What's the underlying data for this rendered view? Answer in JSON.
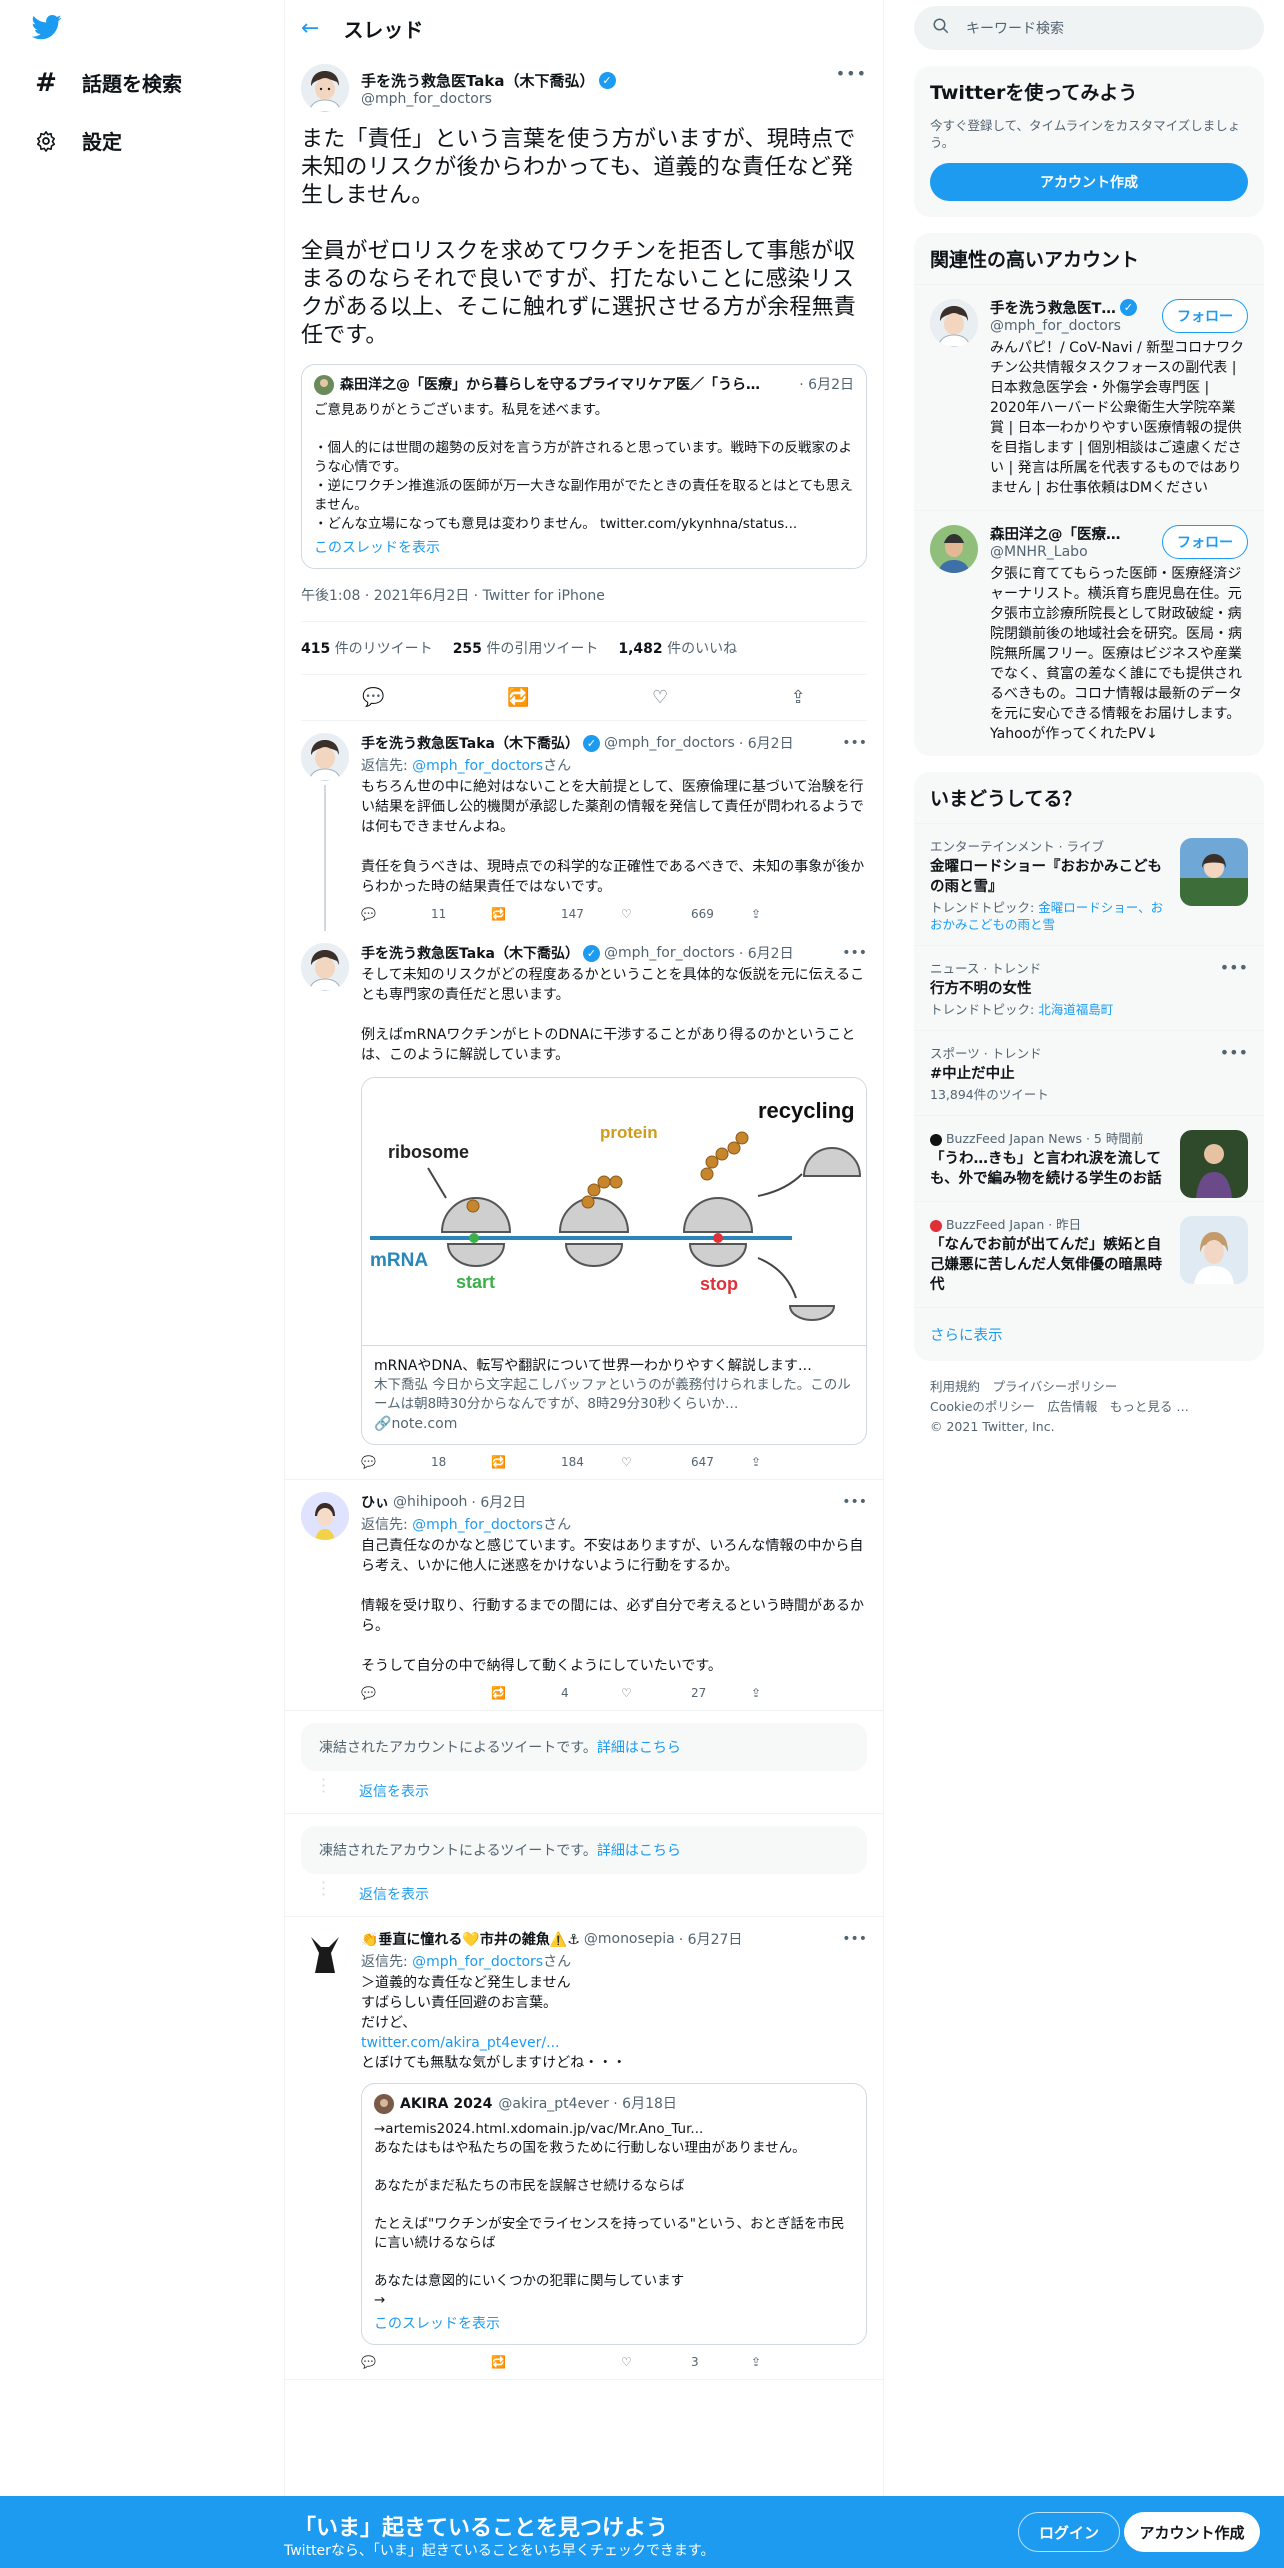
{
  "left_nav": {
    "items": [
      {
        "icon": "hashtag-icon",
        "label": "話題を検索"
      },
      {
        "icon": "gear-icon",
        "label": "設定"
      }
    ]
  },
  "header": {
    "title": "スレッド"
  },
  "focal": {
    "name": "手を洗う救急医Taka（木下喬弘）",
    "handle": "@mph_for_doctors",
    "text": "また「責任」という言葉を使う方がいますが、現時点で未知のリスクが後からわかっても、道義的な責任など発生しません。\n\n全員がゼロリスクを求めてワクチンを拒否して事態が収まるのならそれで良いですが、打たないことに感染リスクがある以上、そこに触れずに選択させる方が余程無責任です。",
    "quote": {
      "name": "森田洋之@「医療」から暮らしを守るプライマリケア医／「うら…",
      "date": "· 6月2日",
      "text": "ご意見ありがとうございます。私見を述べます。\n\n・個人的には世間の趨勢の反対を言う方が許されると思っています。戦時下の反戦家のような心情です。\n・逆にワクチン推進派の医師が万一大きな副作用がでたときの責任を取るとはとても思えません。\n・どんな立場になっても意見は変わりません。",
      "link": "twitter.com/ykynhna/status...",
      "show_thread": "このスレッドを表示"
    },
    "meta": "午後1:08 · 2021年6月2日 · Twitter for iPhone",
    "retweets": "415",
    "retweets_label": "件のリツイート",
    "quotes": "255",
    "quotes_label": "件の引用ツイート",
    "likes": "1,482",
    "likes_label": "件のいいね"
  },
  "replies": [
    {
      "name": "手を洗う救急医Taka（木下喬弘）",
      "handle": "@mph_for_doctors",
      "date": "· 6月2日",
      "reply_prefix": "返信先: ",
      "reply_to": "@mph_for_doctors",
      "reply_suffix": "さん",
      "text": "もちろん世の中に絶対はないことを大前提として、医療倫理に基づいて治験を行い結果を評価し公的機関が承認した薬剤の情報を発信して責任が問われるようでは何もできませんよね。\n\n責任を負うべきは、現時点での科学的な正確性であるべきで、未知の事象が後からわかった時の結果責任ではないです。",
      "reply_count": "11",
      "retweet_count": "147",
      "like_count": "669"
    },
    {
      "name": "手を洗う救急医Taka（木下喬弘）",
      "handle": "@mph_for_doctors",
      "date": "· 6月2日",
      "text": "そして未知のリスクがどの程度あるかということを具体的な仮説を元に伝えることも専門家の責任だと思います。\n\n例えばmRNAワクチンがヒトのDNAに干渉することがあり得るのかということは、このように解説しています。",
      "card": {
        "labels": {
          "ribosome": "ribosome",
          "protein": "protein",
          "recycling": "recycling",
          "mrna": "mRNA",
          "start": "start",
          "stop": "stop"
        },
        "title": "mRNAやDNA、転写や翻訳について世界一わかりやすく解説します…",
        "desc": "木下喬弘 今日から文字起こしバッファというのが義務付けられました。このルームは朝8時30分からなんですが、8時29分30秒くらいか…",
        "domain": "note.com"
      },
      "reply_count": "18",
      "retweet_count": "184",
      "like_count": "647"
    },
    {
      "name": "ひぃ",
      "handle": "@hihipooh",
      "date": "· 6月2日",
      "reply_prefix": "返信先: ",
      "reply_to": "@mph_for_doctors",
      "reply_suffix": "さん",
      "text": "自己責任なのかなと感じています。不安はありますが、いろんな情報の中から自ら考え、いかに他人に迷惑をかけないように行動をするか。\n\n情報を受け取り、行動するまでの間には、必ず自分で考えるという時間があるから。\n\nそうして自分の中で納得して動くようにしていたいです。",
      "reply_count": "",
      "retweet_count": "4",
      "like_count": "27"
    }
  ],
  "frozen": [
    {
      "text": "凍結されたアカウントによるツイートです。",
      "link": "詳細はこちら",
      "show_replies": "返信を表示"
    },
    {
      "text": "凍結されたアカウントによるツイートです。",
      "link": "詳細はこちら",
      "show_replies": "返信を表示"
    }
  ],
  "last_reply": {
    "name": "👏垂直に憧れる💛市井の雑魚⚠️⚓",
    "handle": "@monosepia",
    "date": "· 6月27日",
    "reply_prefix": "返信先: ",
    "reply_to": "@mph_for_doctors",
    "reply_suffix": "さん",
    "text1": "＞道義的な責任など発生しません\nすばらしい責任回避のお言葉。\nだけど、",
    "link": "twitter.com/akira_pt4ever/...",
    "text2": "とぼけても無駄な気がしますけどね・・・",
    "quote": {
      "name": "AKIRA 2024",
      "handle": "@akira_pt4ever · 6月18日",
      "text": "→artemis2024.html.xdomain.jp/vac/Mr.Ano_Tur...\nあなたはもはや私たちの国を救うために行動しない理由がありません。\n\nあなたがまだ私たちの市民を誤解させ続けるならば\n\nたとえば\"ワクチンが安全でライセンスを持っている\"という、おとぎ話を市民に言い続けるならば\n\nあなたは意図的にいくつかの犯罪に関与しています\n→",
      "show_thread": "このスレッドを表示"
    },
    "reply_count": "",
    "retweet_count": "",
    "like_count": "3"
  },
  "right": {
    "search_placeholder": "キーワード検索",
    "try": {
      "title": "Twitterを使ってみよう",
      "sub": "今すぐ登録して、タイムラインをカスタマイズしましょう。",
      "button": "アカウント作成"
    },
    "related": {
      "title": "関連性の高いアカウント",
      "follow_label": "フォロー",
      "accounts": [
        {
          "name": "手を洗う救急医T…",
          "handle": "@mph_for_doctors",
          "bio": "みんパピ！/ CoV-Navi / 新型コロナワクチン公共情報タスクフォースの副代表 | 日本救急医学会・外傷学会専門医 | 2020年ハーバード公衆衛生大学院卒業賞 | 日本一わかりやすい医療情報の提供を目指します | 個別相談はご遠慮ください | 発言は所属を代表するものではありません | お仕事依頼はDMください"
        },
        {
          "name": "森田洋之@「医療…",
          "handle": "@MNHR_Labo",
          "bio": "夕張に育ててもらった医師・医療経済ジャーナリスト。横浜育ち鹿児島在住。元夕張市立診療所院長として財政破綻・病院閉鎖前後の地域社会を研究。医局・病院無所属フリー。医療はビジネスや産業でなく、貧富の差なく誰にでも提供されるべきもの。コロナ情報は最新のデータを元に安心できる情報をお届けします。Yahooが作ってくれたPV↓"
        }
      ]
    },
    "trends": {
      "title": "いまどうしてる？",
      "items": [
        {
          "category": "エンターテインメント · ライブ",
          "title": "金曜ロードショー『おおかみこどもの雨と雪』",
          "sub_prefix": "トレンドトピック: ",
          "sub_link": "金曜ロードショー、おおかみこどもの雨と雪"
        },
        {
          "category": "ニュース · トレンド",
          "title": "行方不明の女性",
          "sub_prefix": "トレンドトピック: ",
          "sub_link": "北海道福島町"
        },
        {
          "category": "スポーツ · トレンド",
          "title": "#中止だ中止",
          "sub_prefix": "13,894件のツイート",
          "sub_link": ""
        },
        {
          "category": "BuzzFeed Japan News · 5 時間前",
          "title": "「うわ…きも」と言われ涙を流しても、外で編み物を続ける学生のお話",
          "sub_prefix": "",
          "sub_link": ""
        },
        {
          "category": "BuzzFeed Japan · 昨日",
          "title": "「なんでお前が出てんだ」嫉妬と自己嫌悪に苦しんだ人気俳優の暗黒時代",
          "sub_prefix": "",
          "sub_link": ""
        }
      ],
      "more": "さらに表示"
    },
    "footer": {
      "l1": "利用規約　プライバシーポリシー",
      "l2": "Cookieのポリシー　広告情報　もっと見る …",
      "l3": "© 2021 Twitter, Inc."
    }
  },
  "bottom_bar": {
    "title": "「いま」起きていることを見つけよう",
    "sub": "Twitterなら、「いま」起きていることをいち早くチェックできます。",
    "login": "ログイン",
    "signup": "アカウント作成"
  },
  "colors": {
    "accent": "#1d9bf0",
    "text": "#0f1419",
    "muted": "#536471",
    "border": "#eff3f4"
  }
}
